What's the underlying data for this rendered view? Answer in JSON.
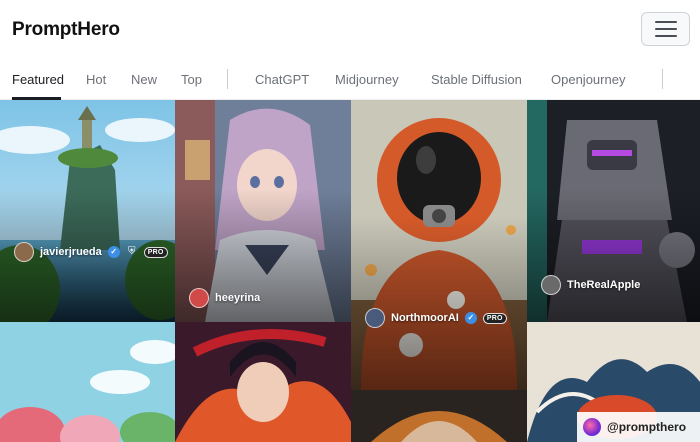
{
  "header": {
    "logo": "PromptHero",
    "menu_icon": "hamburger-menu-icon"
  },
  "tabs": [
    {
      "label": "Featured",
      "active": true
    },
    {
      "label": "Hot",
      "active": false
    },
    {
      "label": "New",
      "active": false
    },
    {
      "label": "Top",
      "active": false
    },
    {
      "label": "ChatGPT",
      "active": false
    },
    {
      "label": "Midjourney",
      "active": false
    },
    {
      "label": "Stable Diffusion",
      "active": false
    },
    {
      "label": "Openjourney",
      "active": false
    }
  ],
  "cards": [
    {
      "author": "javierjrueda",
      "verified": true,
      "shield": true,
      "pro": "PRO",
      "theme": "floating-island"
    },
    {
      "author": "heeyrina",
      "verified": false,
      "shield": false,
      "pro": "",
      "theme": "anime-girl"
    },
    {
      "author": "NorthmoorAI",
      "verified": true,
      "shield": false,
      "pro": "PRO",
      "theme": "astronaut"
    },
    {
      "author": "TheRealApple",
      "verified": false,
      "shield": false,
      "pro": "",
      "theme": "robot"
    },
    {
      "author": "",
      "theme": "pastel-landscape"
    },
    {
      "author": "",
      "theme": "anime-warrior"
    },
    {
      "author": "",
      "theme": "cyber-portrait"
    },
    {
      "author": "",
      "theme": "wave-dragon"
    }
  ],
  "watermark": {
    "text": "@prompthero"
  },
  "colors": {
    "accent": "#1a1d21",
    "verified": "#3b8fe6"
  }
}
